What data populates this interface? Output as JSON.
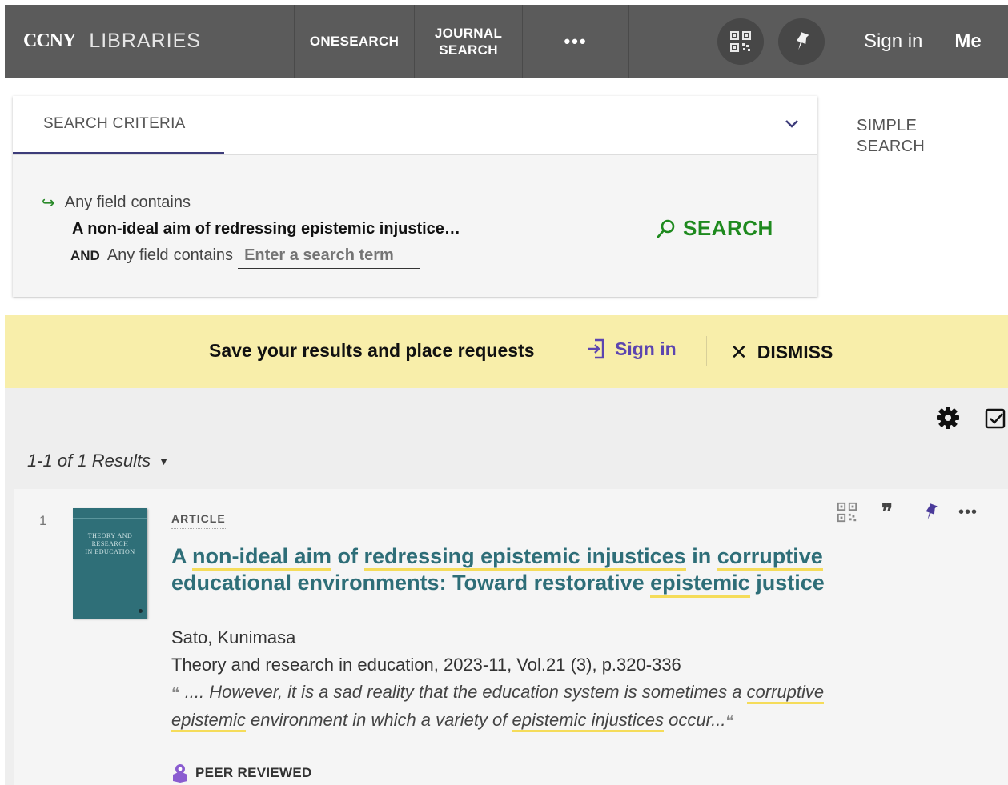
{
  "nav": {
    "brand_ccny": "CCNY",
    "brand_libraries": "LIBRARIES",
    "onesearch": "ONESEARCH",
    "journal_line1": "JOURNAL",
    "journal_line2": "SEARCH",
    "more": "•••",
    "sign_in": "Sign in",
    "menu": "Me"
  },
  "search_panel": {
    "tab_label": "SEARCH CRITERIA",
    "row1_field": "Any field",
    "row1_op": "contains",
    "query": "A non-ideal aim of redressing epistemic injustice…",
    "row2_bool": "AND",
    "row2_field": "Any field",
    "row2_op": "contains",
    "row2_placeholder": "Enter a search term",
    "search_button": "SEARCH",
    "simple_line1": "SIMPLE",
    "simple_line2": "SEARCH"
  },
  "banner": {
    "message": "Save your results and place requests",
    "sign_in": "Sign in",
    "dismiss": "DISMISS"
  },
  "results": {
    "count_label": "1-1 of 1 Results",
    "items": [
      {
        "index": "1",
        "cover_title_l1": "THEORY AND",
        "cover_title_l2": "RESEARCH",
        "cover_title_l3": "IN EDUCATION",
        "type": "ARTICLE",
        "title_parts": {
          "a": "A ",
          "b": "non-ideal aim",
          "c": " of ",
          "d": "redressing epistemic injustices",
          "e": " in ",
          "f": "corruptive",
          "g": " educational environments: Toward restorative ",
          "h": "epistemic",
          "i": " justice"
        },
        "author": "Sato, Kunimasa",
        "source": "Theory and research in education, 2023-11, Vol.21 (3), p.320-336",
        "snippet_parts": {
          "open_quote": "❝",
          "a": " .... However, it is a sad reality that the education system is sometimes a ",
          "b": "corruptive epistemic",
          "c": " environment in which a variety of ",
          "d": "epistemic injustices",
          "e": " occur...",
          "close_quote": "❝"
        },
        "peer_reviewed": "PEER REVIEWED"
      }
    ]
  },
  "colors": {
    "topbar": "#5b5b5b",
    "accent_green": "#1e8a1e",
    "accent_purple": "#5c45b0",
    "banner_yellow": "#f8eeaa",
    "title_teal": "#2e6e78",
    "highlight": "#f5dc5a"
  },
  "icons": [
    "qr-code-icon",
    "pin-icon",
    "chevron-down-icon",
    "arrow-right-icon",
    "search-icon",
    "sign-in-icon",
    "close-icon",
    "gear-icon",
    "checkbox-icon",
    "caret-down-icon",
    "quote-icon",
    "more-icon",
    "peer-reviewed-icon"
  ]
}
